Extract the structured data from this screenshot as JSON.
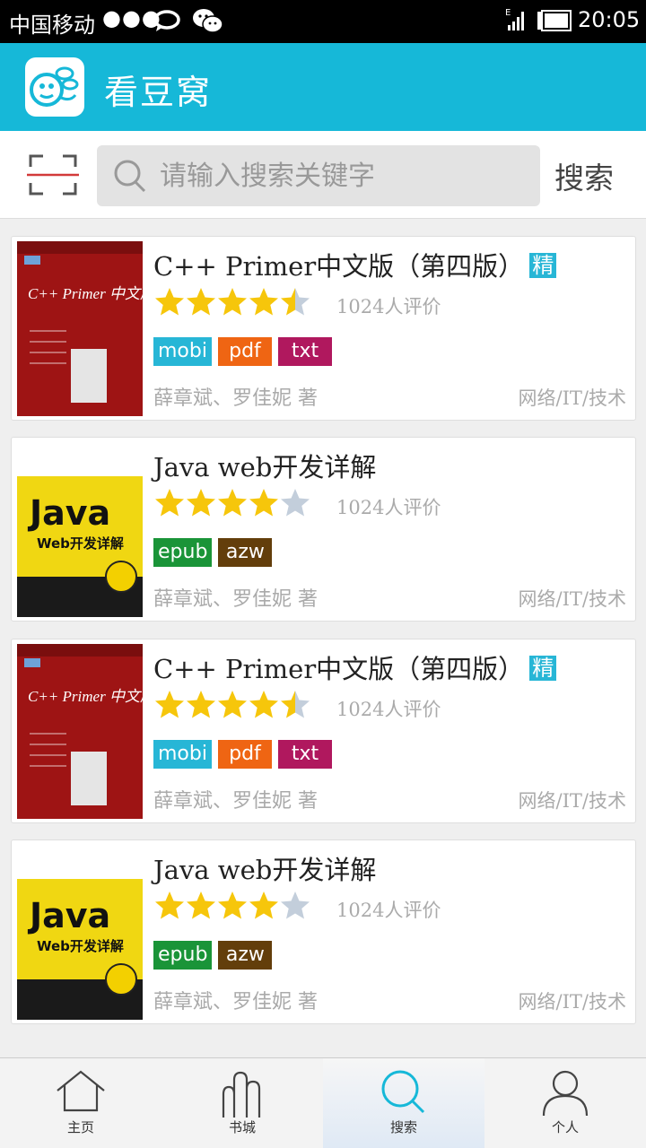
{
  "status_bar": {
    "carrier": "中国移动",
    "dots": "●●●",
    "network": "E",
    "time": "20:05"
  },
  "app": {
    "title": "看豆窝",
    "accent_color": "#16b8d8"
  },
  "search": {
    "placeholder": "请输入搜索关键字",
    "value": "",
    "button_label": "搜索"
  },
  "books": [
    {
      "title": "C++ Primer中文版（第四版）",
      "badge": "精",
      "rating": 4.5,
      "rating_count": "1024人评价",
      "formats": [
        {
          "label": "mobi",
          "color": "#27b6d6"
        },
        {
          "label": "pdf",
          "color": "#ef6513"
        },
        {
          "label": "txt",
          "color": "#b0185e"
        }
      ],
      "author": "薛章斌、罗佳妮 著",
      "category": "网络/IT/技术",
      "cover": {
        "style": "cpp",
        "title": "C++ Primer 中文版"
      }
    },
    {
      "title": "Java web开发详解",
      "badge": "",
      "rating": 4,
      "rating_count": "1024人评价",
      "formats": [
        {
          "label": "epub",
          "color": "#1a9438"
        },
        {
          "label": "azw",
          "color": "#633e0b"
        }
      ],
      "author": "薛章斌、罗佳妮 著",
      "category": "网络/IT/技术",
      "cover": {
        "style": "java",
        "title": "Java",
        "subtitle": "Web开发详解"
      }
    },
    {
      "title": "C++ Primer中文版（第四版）",
      "badge": "精",
      "rating": 4.5,
      "rating_count": "1024人评价",
      "formats": [
        {
          "label": "mobi",
          "color": "#27b6d6"
        },
        {
          "label": "pdf",
          "color": "#ef6513"
        },
        {
          "label": "txt",
          "color": "#b0185e"
        }
      ],
      "author": "薛章斌、罗佳妮 著",
      "category": "网络/IT/技术",
      "cover": {
        "style": "cpp",
        "title": "C++ Primer 中文版"
      }
    },
    {
      "title": "Java web开发详解",
      "badge": "",
      "rating": 4,
      "rating_count": "1024人评价",
      "formats": [
        {
          "label": "epub",
          "color": "#1a9438"
        },
        {
          "label": "azw",
          "color": "#633e0b"
        }
      ],
      "author": "薛章斌、罗佳妮 著",
      "category": "网络/IT/技术",
      "cover": {
        "style": "java",
        "title": "Java",
        "subtitle": "Web开发详解"
      }
    }
  ],
  "bottom_nav": [
    {
      "label": "主页",
      "icon": "home-icon",
      "active": false
    },
    {
      "label": "书城",
      "icon": "bookshelf-icon",
      "active": false
    },
    {
      "label": "搜索",
      "icon": "search-icon",
      "active": true
    },
    {
      "label": "个人",
      "icon": "user-icon",
      "active": false
    }
  ]
}
